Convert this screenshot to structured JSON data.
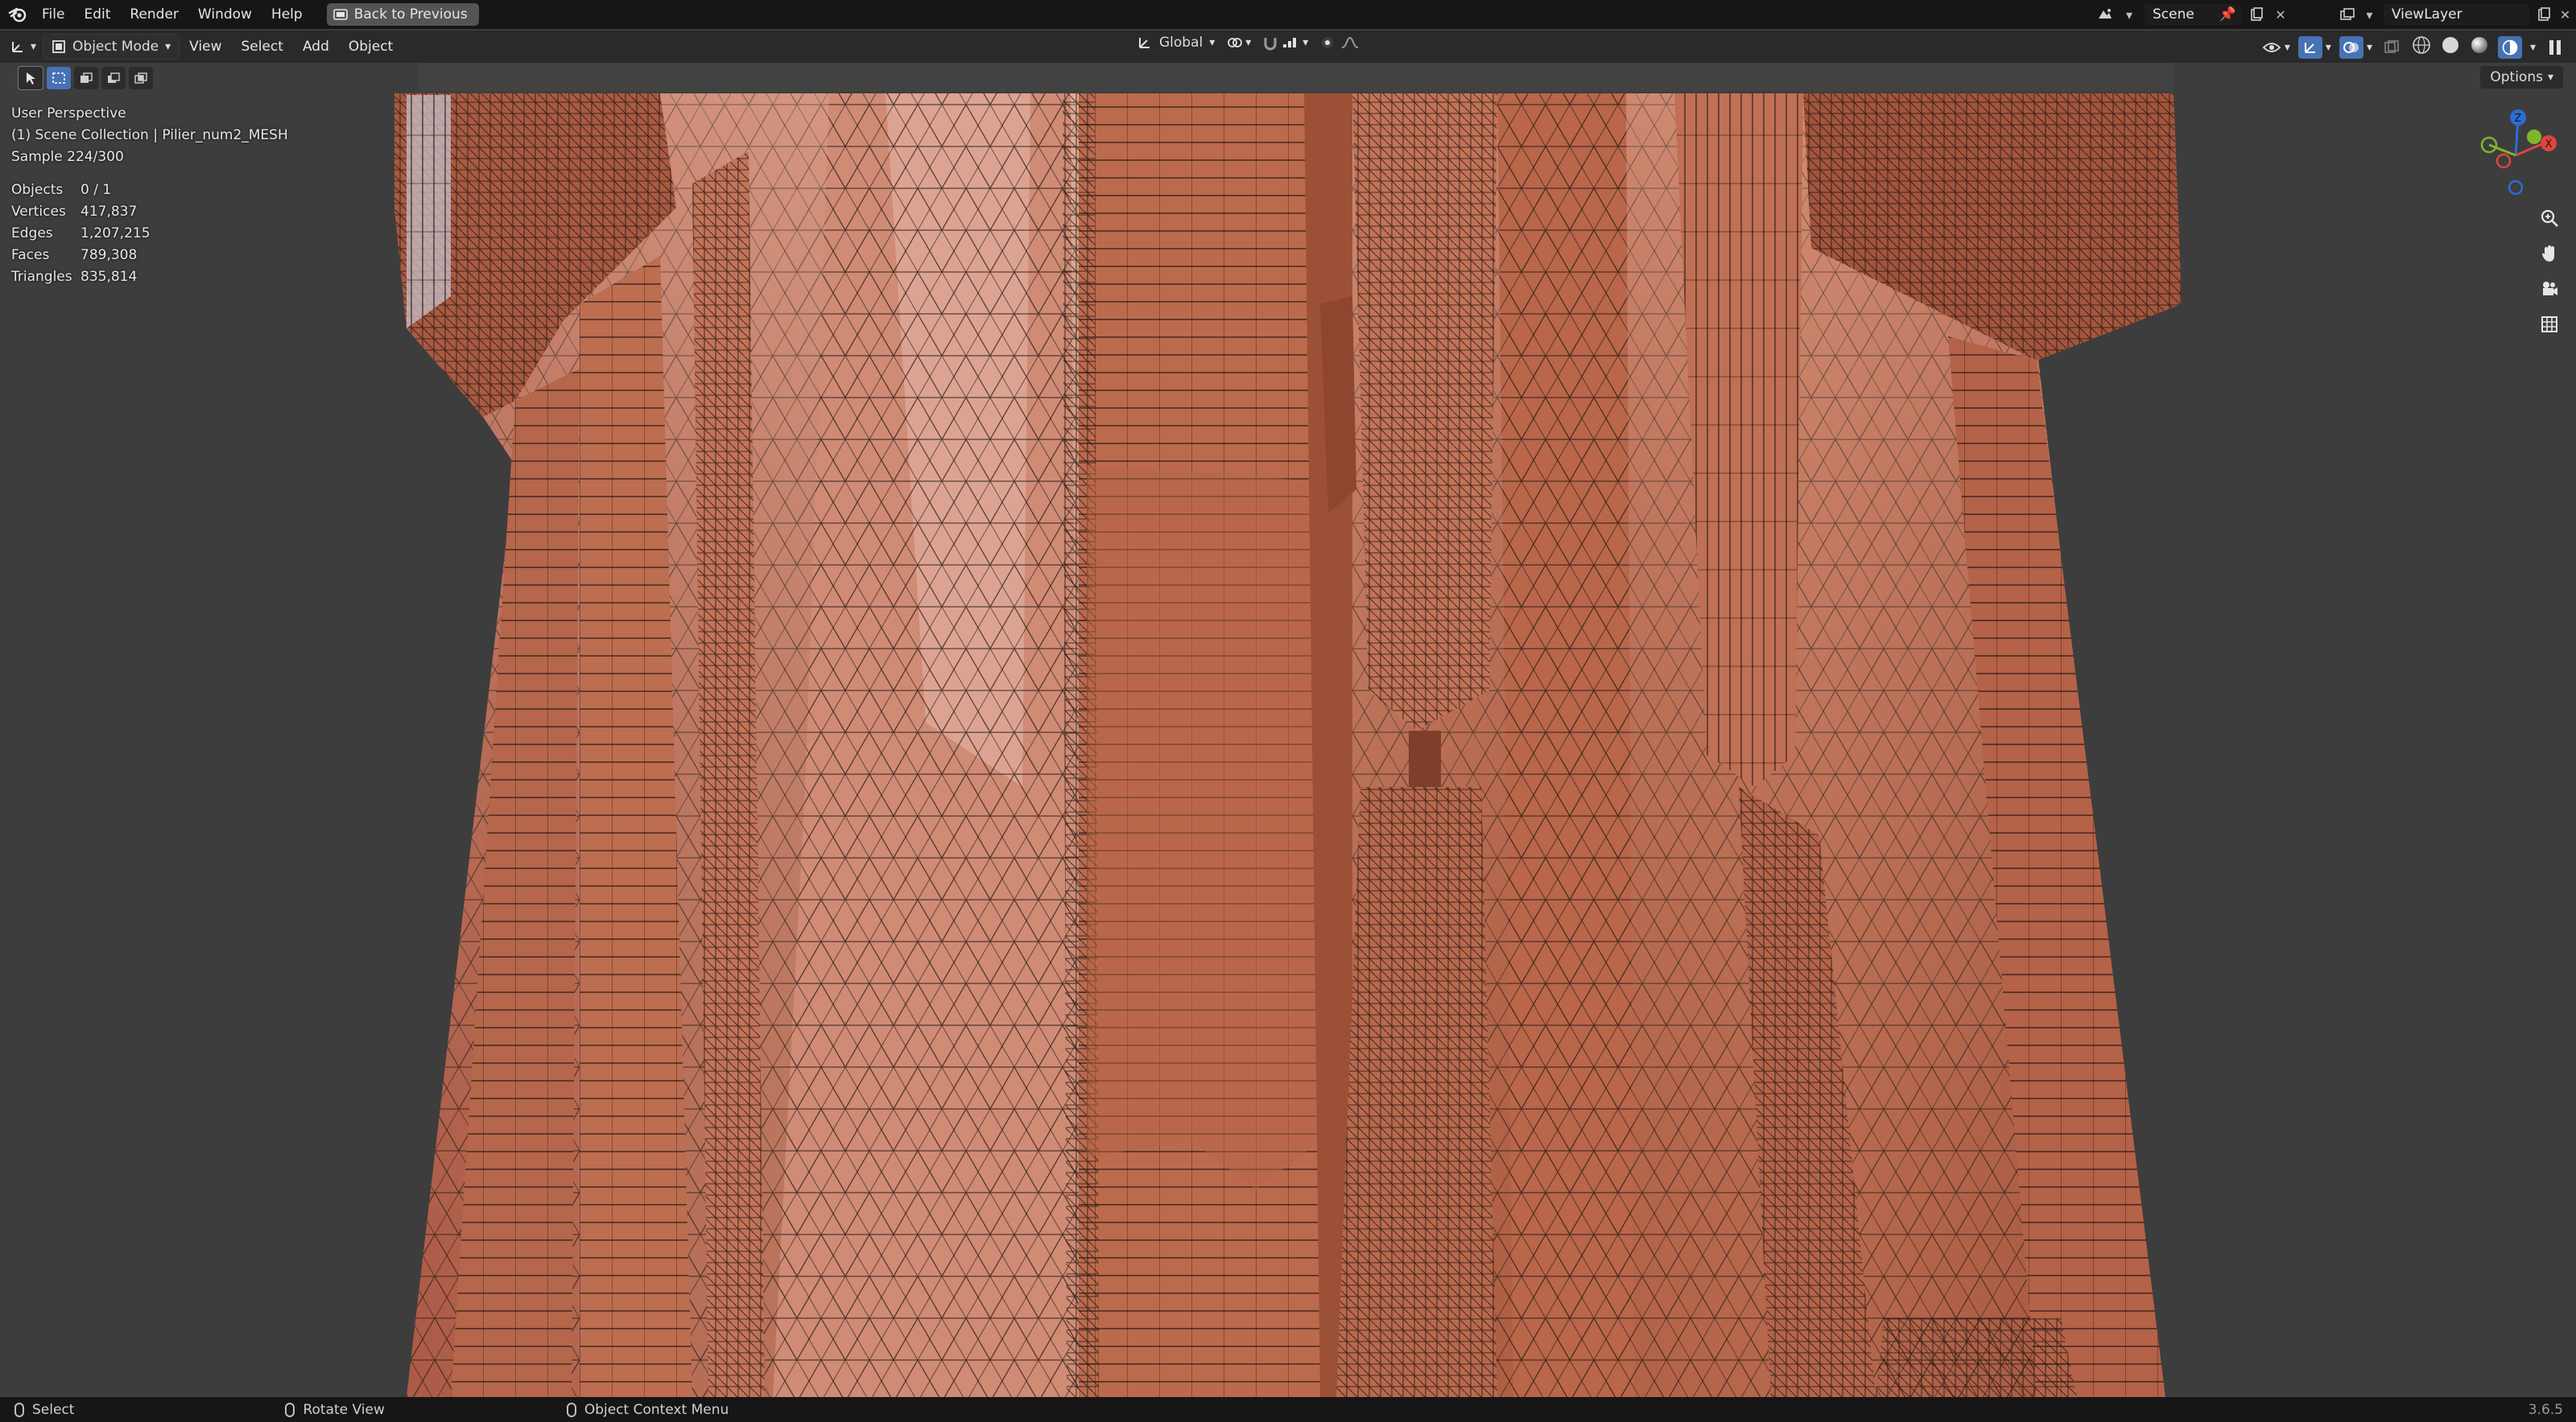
{
  "top_menu": {
    "items": [
      "File",
      "Edit",
      "Render",
      "Window",
      "Help"
    ],
    "back_button": "Back to Previous",
    "scene": "Scene",
    "view_layer": "ViewLayer"
  },
  "viewport_header": {
    "mode": "Object Mode",
    "menus": [
      "View",
      "Select",
      "Add",
      "Object"
    ],
    "orientation": "Global",
    "options": "Options"
  },
  "overlay": {
    "perspective": "User Perspective",
    "collection": "(1) Scene Collection | Pilier_num2_MESH",
    "sample": "Sample 224/300",
    "stats": [
      {
        "label": "Objects",
        "value": "0 / 1"
      },
      {
        "label": "Vertices",
        "value": "417,837"
      },
      {
        "label": "Edges",
        "value": "1,207,215"
      },
      {
        "label": "Faces",
        "value": "789,308"
      },
      {
        "label": "Triangles",
        "value": "835,814"
      }
    ]
  },
  "gizmo": {
    "x": "X",
    "y": "Y",
    "z": "Z"
  },
  "status_bar": {
    "select": "Select",
    "rotate": "Rotate View",
    "context": "Object Context Menu",
    "version": "3.6.5"
  },
  "colors": {
    "mesh": "#b8654a",
    "mesh_dark": "#8e4a33",
    "wire": "#1c1410",
    "background": "#3d3d3d",
    "accent": "#4772b3"
  }
}
